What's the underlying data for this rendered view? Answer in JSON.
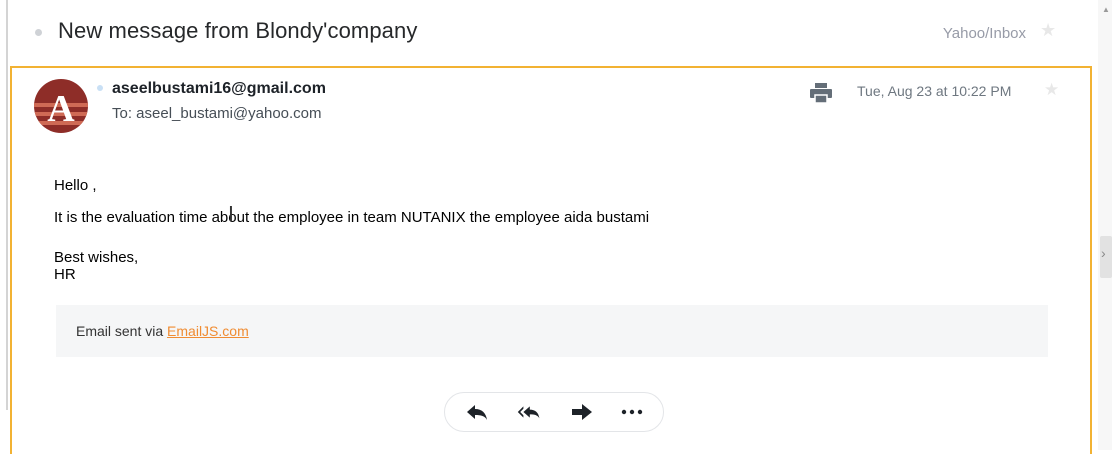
{
  "header": {
    "subject": "New message from Blondy'company",
    "folder": "Yahoo/Inbox"
  },
  "message": {
    "sender_email": "aseelbustami16@gmail.com",
    "to_line": "To: aseel_bustami@yahoo.com",
    "date": "Tue, Aug 23 at 10:22 PM",
    "avatar_letter": "A",
    "body": {
      "greeting": "Hello ,",
      "content": "It is the evaluation time about the employee in team NUTANIX the employee aida bustami",
      "signoff": "Best wishes,",
      "signature": "HR"
    },
    "footer": {
      "prefix": "Email sent via ",
      "link_text": "EmailJS.com"
    }
  },
  "actions": {
    "reply_icon": "reply-icon",
    "reply_all_icon": "reply-all-icon",
    "forward_icon": "forward-icon",
    "more_icon": "more-icon"
  },
  "colors": {
    "card_border": "#f2b233",
    "link": "#f08c32",
    "action_icon": "#1d2228"
  }
}
